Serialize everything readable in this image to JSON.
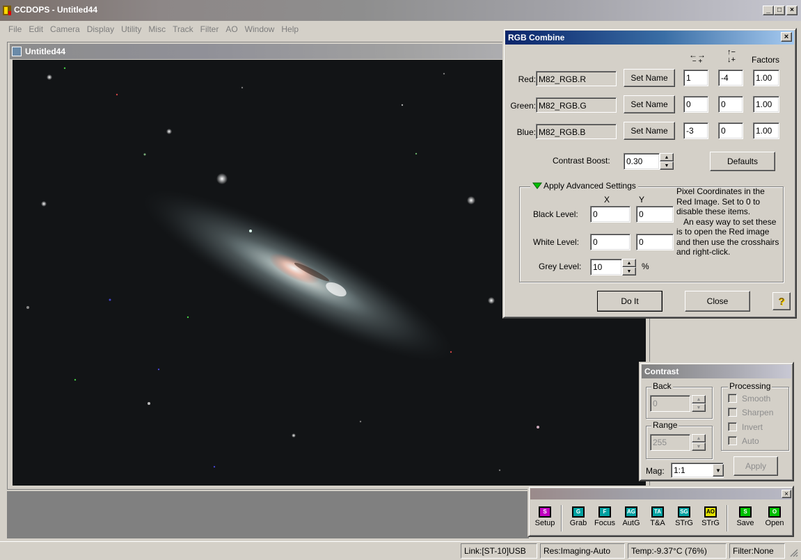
{
  "app": {
    "title": "CCDOPS - Untitled44",
    "menu": [
      "File",
      "Edit",
      "Camera",
      "Display",
      "Utility",
      "Misc",
      "Track",
      "Filter",
      "AO",
      "Window",
      "Help"
    ],
    "window_controls": {
      "min": "_",
      "max": "□",
      "close": "×"
    }
  },
  "image_window": {
    "title": "Untitled44"
  },
  "rgb_combine": {
    "title": "RGB Combine",
    "close": "×",
    "col_headers": {
      "h_shift": "←→",
      "h_shift_sub": "− +",
      "v_shift_top": "↑−",
      "v_shift_bot": "↓+",
      "factors": "Factors"
    },
    "rows": [
      {
        "label": "Red:",
        "name": "M82_RGB.R",
        "button": "Set Name",
        "x": "1",
        "y": "-4",
        "factor": "1.00"
      },
      {
        "label": "Green:",
        "name": "M82_RGB.G",
        "button": "Set Name",
        "x": "0",
        "y": "0",
        "factor": "1.00"
      },
      {
        "label": "Blue:",
        "name": "M82_RGB.B",
        "button": "Set Name",
        "x": "-3",
        "y": "0",
        "factor": "1.00"
      }
    ],
    "contrast_boost_label": "Contrast Boost:",
    "contrast_boost_value": "0.30",
    "defaults_button": "Defaults",
    "advanced": {
      "legend": "Apply Advanced Settings",
      "x_header": "X",
      "y_header": "Y",
      "black_label": "Black Level:",
      "black_x": "0",
      "black_y": "0",
      "white_label": "White Level:",
      "white_x": "0",
      "white_y": "0",
      "grey_label": "Grey Level:",
      "grey_value": "10",
      "grey_unit": "%",
      "help_text_1": "Pixel Coordinates in the Red Image.  Set to 0 to disable these items.",
      "help_text_2": "An easy way to set these is to open the Red image and then use the crosshairs and right-click."
    },
    "do_it_button": "Do It",
    "close_button": "Close",
    "help_button": "?"
  },
  "contrast": {
    "title": "Contrast",
    "back_legend": "Back",
    "back_value": "0",
    "range_legend": "Range",
    "range_value": "255",
    "processing_legend": "Processing",
    "options": [
      "Smooth",
      "Sharpen",
      "Invert",
      "Auto"
    ],
    "apply_button": "Apply",
    "mag_label": "Mag:",
    "mag_value": "1:1"
  },
  "toolbar": {
    "close": "×",
    "tools": [
      {
        "icon": "S",
        "label": "Setup",
        "color": "#c000c0"
      },
      {
        "icon": "G",
        "label": "Grab",
        "color": "#00a0a0"
      },
      {
        "icon": "F",
        "label": "Focus",
        "color": "#00a0a0"
      },
      {
        "icon": "AG",
        "label": "AutG",
        "color": "#00a0a0"
      },
      {
        "icon": "TA",
        "label": "T&A",
        "color": "#00a0a0"
      },
      {
        "icon": "SG",
        "label": "STrG",
        "color": "#00a0a0"
      },
      {
        "icon": "AO",
        "label": "STrG",
        "color": "#e0e000"
      },
      {
        "icon": "S",
        "label": "Save",
        "color": "#00c000"
      },
      {
        "icon": "O",
        "label": "Open",
        "color": "#00c000"
      }
    ]
  },
  "status": {
    "link": "Link:[ST-10]USB",
    "res": "Res:Imaging-Auto",
    "temp": "Temp:-9.37°C (76%)",
    "filter": "Filter:None"
  },
  "colors": {
    "dialog_title_start": "#0a246a",
    "dialog_title_end": "#a6caf0",
    "inactive_title": "#808080"
  }
}
